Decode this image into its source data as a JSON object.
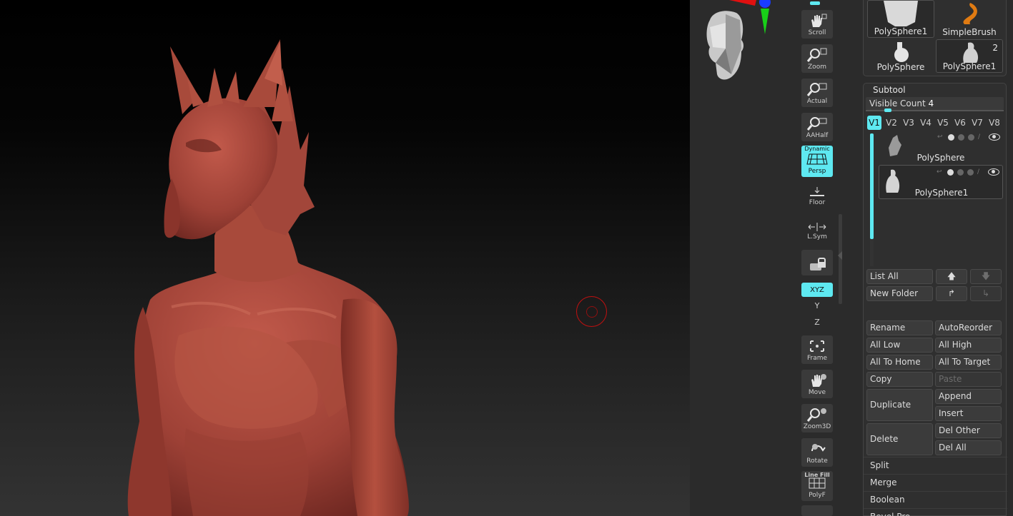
{
  "toolbar": {
    "scroll": "Scroll",
    "zoom": "Zoom",
    "actual": "Actual",
    "aahalf": "AAHalf",
    "persp_top": "Dynamic",
    "persp": "Persp",
    "floor": "Floor",
    "lsym": "L.Sym",
    "xyz": "XYZ",
    "rot_y": "Y",
    "rot_z": "Z",
    "frame": "Frame",
    "move": "Move",
    "zoom3d": "Zoom3D",
    "rotate": "Rotate",
    "polyf_top": "Line Fill",
    "polyf": "PolyF"
  },
  "thumbs": [
    {
      "label": "PolySphere1",
      "selected": true
    },
    {
      "label": "SimpleBrush",
      "selected": false
    },
    {
      "label": "PolySphere",
      "selected": false
    },
    {
      "label": "PolySphere1",
      "selected": true,
      "badge": "2"
    }
  ],
  "subtool": {
    "title": "Subtool",
    "visible_count_label": "Visible Count",
    "visible_count": "4",
    "visible_fraction": 0.15,
    "tabs": [
      "V1",
      "V2",
      "V3",
      "V4",
      "V5",
      "V6",
      "V7",
      "V8"
    ],
    "active_tab": "V1",
    "items": [
      {
        "name": "PolySphere",
        "selected": false
      },
      {
        "name": "PolySphere1",
        "selected": true
      }
    ],
    "buttons": {
      "list_all": "List All",
      "new_folder": "New Folder",
      "rename": "Rename",
      "autoreorder": "AutoReorder",
      "all_low": "All Low",
      "all_high": "All High",
      "all_to_home": "All To Home",
      "all_to_target": "All To Target",
      "copy": "Copy",
      "paste": "Paste",
      "duplicate": "Duplicate",
      "append": "Append",
      "insert": "Insert",
      "delete": "Delete",
      "del_other": "Del Other",
      "del_all": "Del All"
    },
    "menus": [
      "Split",
      "Merge",
      "Boolean",
      "Bevel Pro"
    ]
  },
  "colors": {
    "accent": "#5ee9f1",
    "model": "#a8483c",
    "cursor": "#c01010"
  }
}
